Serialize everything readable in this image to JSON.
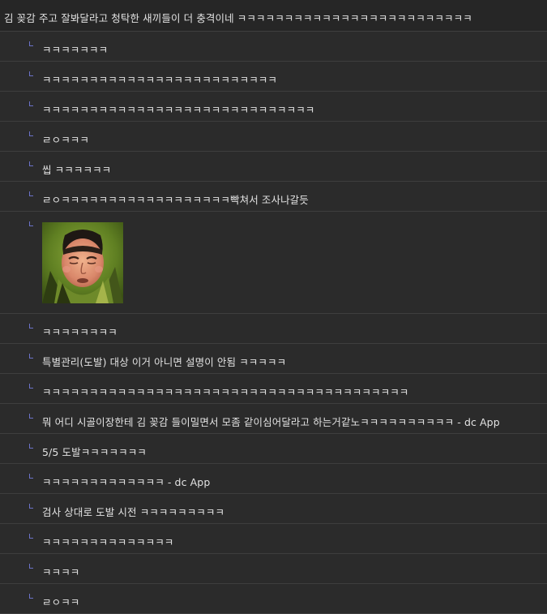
{
  "post": {
    "title": "김 꽂감 주고 잘봐달라고 청탁한 새끼들이 더 충격이네 ㅋㅋㅋㅋㅋㅋㅋㅋㅋㅋㅋㅋㅋㅋㅋㅋㅋㅋㅋㅋㅋㅋㅋㅋㅋ"
  },
  "replies": [
    {
      "text": "ㅋㅋㅋㅋㅋㅋㅋ"
    },
    {
      "text": "ㅋㅋㅋㅋㅋㅋㅋㅋㅋㅋㅋㅋㅋㅋㅋㅋㅋㅋㅋㅋㅋㅋㅋㅋㅋ"
    },
    {
      "text": "ㅋㅋㅋㅋㅋㅋㅋㅋㅋㅋㅋㅋㅋㅋㅋㅋㅋㅋㅋㅋㅋㅋㅋㅋㅋㅋㅋㅋㅋ"
    },
    {
      "text": "ㄹㅇㅋㅋㅋ"
    },
    {
      "text": "씹 ㅋㅋㅋㅋㅋㅋ"
    },
    {
      "text": "ㄹㅇㅋㅋㅋㅋㅋㅋㅋㅋㅋㅋㅋㅋㅋㅋㅋㅋㅋㅋ빡쳐서 조사나갈듯"
    },
    {
      "image": "dccon-crying-man"
    },
    {
      "text": "ㅋㅋㅋㅋㅋㅋㅋㅋ"
    },
    {
      "text": "특별관리(도발) 대상 이거 아니면 설명이 안됨 ㅋㅋㅋㅋㅋ"
    },
    {
      "text": "ㅋㅋㅋㅋㅋㅋㅋㅋㅋㅋㅋㅋㅋㅋㅋㅋㅋㅋㅋㅋㅋㅋㅋㅋㅋㅋㅋㅋㅋㅋㅋㅋㅋㅋㅋㅋㅋㅋㅋ"
    },
    {
      "text": "뭐 어디 시골이장한테 김 꽂감 들이밀면서 모좀 같이심어달라고 하는거같노ㅋㅋㅋㅋㅋㅋㅋㅋㅋㅋ - dc App"
    },
    {
      "text": "5/5 도발ㅋㅋㅋㅋㅋㅋㅋ"
    },
    {
      "text": "ㅋㅋㅋㅋㅋㅋㅋㅋㅋㅋㅋㅋㅋ - dc App"
    },
    {
      "text": "검사 상대로 도발 시전 ㅋㅋㅋㅋㅋㅋㅋㅋㅋ"
    },
    {
      "text": "ㅋㅋㅋㅋㅋㅋㅋㅋㅋㅋㅋㅋㅋㅋ"
    },
    {
      "text": "ㅋㅋㅋㅋ"
    },
    {
      "text": "ㄹㅇㅋㅋ"
    }
  ]
}
